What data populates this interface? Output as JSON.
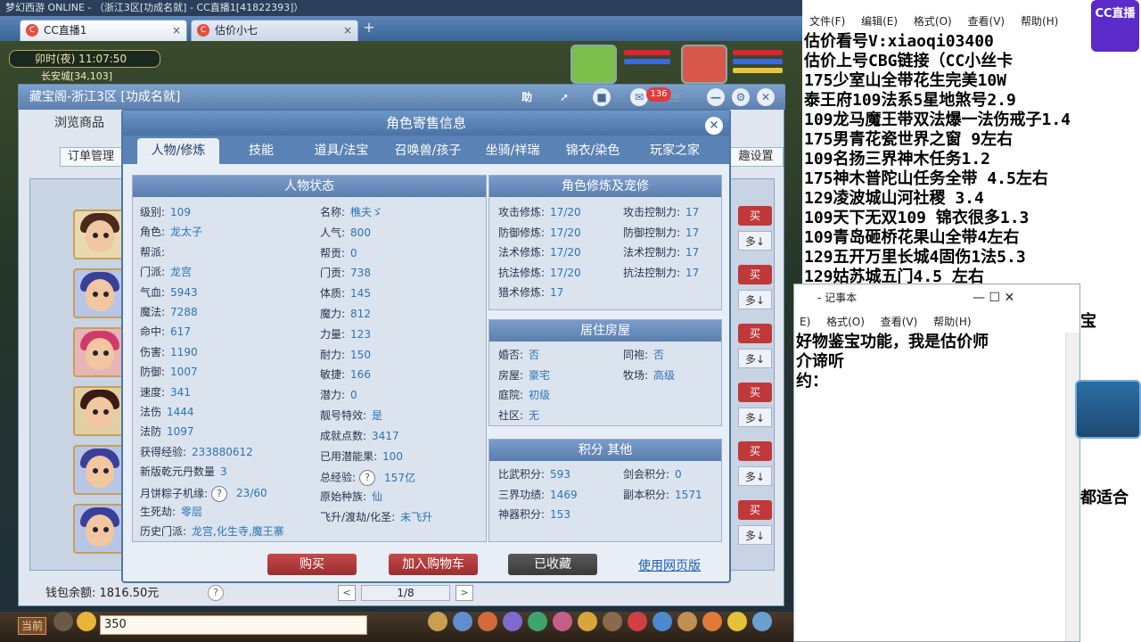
{
  "browser": {
    "title": "梦幻西游 ONLINE - （浙江3区[功成名就] - CC直播1[41822393]）",
    "tabs": [
      {
        "label": "CC直播1",
        "close": "×"
      },
      {
        "label": "估价小七",
        "close": "×"
      }
    ],
    "new_tab": "+"
  },
  "game_hud": {
    "time": "卯时(夜) 11:07:50",
    "location": "长安城[34,103]"
  },
  "shop": {
    "title": "藏宝阁-浙江3区 [功成名就]",
    "help": "助",
    "cart_count": "136",
    "browse_tab": "浏览商品",
    "order_btn": "订单管理",
    "settings_btn": "趣设置",
    "buy_stub": "买",
    "arrow_stub": "多↓",
    "wallet_label": "钱包余额: 1816.50元",
    "wallet_help": "?",
    "pager_prev": "<",
    "pager_text": "1/8",
    "pager_next": ">"
  },
  "modal": {
    "title": "角色寄售信息",
    "close": "×",
    "tabs": [
      "人物/修炼",
      "技能",
      "道具/法宝",
      "召唤兽/孩子",
      "坐骑/祥瑞",
      "锦衣/染色",
      "玩家之家"
    ],
    "status_title": "人物状态",
    "status_left": [
      {
        "k": "级别:",
        "v": "109"
      },
      {
        "k": "角色:",
        "v": "龙太子"
      },
      {
        "k": "帮派:",
        "v": ""
      },
      {
        "k": "门派:",
        "v": "龙宫"
      },
      {
        "k": "气血:",
        "v": "5943"
      },
      {
        "k": "魔法:",
        "v": "7288"
      },
      {
        "k": "命中:",
        "v": "617"
      },
      {
        "k": "伤害:",
        "v": "1190"
      },
      {
        "k": "防御:",
        "v": "1007"
      },
      {
        "k": "速度:",
        "v": "341"
      },
      {
        "k": "法伤",
        "v": "1444"
      },
      {
        "k": "法防",
        "v": "1097"
      },
      {
        "k": "获得经验:",
        "v": "233880612"
      },
      {
        "k": "新版乾元丹数量",
        "v": "3"
      },
      {
        "k": "月饼粽子机缘:",
        "v": "23/60"
      },
      {
        "k": "生死劫:",
        "v": "零层"
      },
      {
        "k": "历史门派:",
        "v": "龙宫,化生寺,魔王寨"
      }
    ],
    "status_right": [
      {
        "k": "名称:",
        "v": "樵夫ゞ"
      },
      {
        "k": "人气:",
        "v": "800"
      },
      {
        "k": "帮贡:",
        "v": "0"
      },
      {
        "k": "门贡:",
        "v": "738"
      },
      {
        "k": "体质:",
        "v": "145"
      },
      {
        "k": "魔力:",
        "v": "812"
      },
      {
        "k": "力量:",
        "v": "123"
      },
      {
        "k": "耐力:",
        "v": "150"
      },
      {
        "k": "敏捷:",
        "v": "166"
      },
      {
        "k": "潜力:",
        "v": "0"
      },
      {
        "k": "靓号特效:",
        "v": "是"
      },
      {
        "k": "成就点数:",
        "v": "3417"
      },
      {
        "k": "已用潜能果:",
        "v": "100"
      },
      {
        "k": "总经验:",
        "v": "157亿"
      },
      {
        "k": "原始种族:",
        "v": "仙"
      },
      {
        "k": "飞升/渡劫/化圣:",
        "v": "未飞升"
      }
    ],
    "cultivation_title": "角色修炼及宠修",
    "cultivation_left": [
      {
        "k": "攻击修炼:",
        "v": "17/20"
      },
      {
        "k": "防御修炼:",
        "v": "17/20"
      },
      {
        "k": "法术修炼:",
        "v": "17/20"
      },
      {
        "k": "抗法修炼:",
        "v": "17/20"
      },
      {
        "k": "猎术修炼:",
        "v": "17"
      }
    ],
    "cultivation_right": [
      {
        "k": "攻击控制力:",
        "v": "17"
      },
      {
        "k": "防御控制力:",
        "v": "17"
      },
      {
        "k": "法术控制力:",
        "v": "17"
      },
      {
        "k": "抗法控制力:",
        "v": "17"
      }
    ],
    "housing_title": "居住房屋",
    "housing_left": [
      {
        "k": "婚否:",
        "v": "否"
      },
      {
        "k": "房屋:",
        "v": "豪宅"
      },
      {
        "k": "庭院:",
        "v": "初级"
      },
      {
        "k": "社区:",
        "v": "无"
      }
    ],
    "housing_right": [
      {
        "k": "同袍:",
        "v": "否"
      },
      {
        "k": "牧场:",
        "v": "高级"
      }
    ],
    "points_title": "积分 其他",
    "points_left": [
      {
        "k": "比武积分:",
        "v": "593"
      },
      {
        "k": "三界功绩:",
        "v": "1469"
      },
      {
        "k": "神器积分:",
        "v": "153"
      }
    ],
    "points_right": [
      {
        "k": "剑会积分:",
        "v": "0"
      },
      {
        "k": "副本积分:",
        "v": "1571"
      }
    ],
    "buttons": {
      "buy": "购买",
      "add_cart": "加入购物车",
      "saved": "已收藏",
      "web": "使用网页版"
    },
    "qmark": "?"
  },
  "bottombar": {
    "chat_tab": "当前",
    "chat_input": "350"
  },
  "notepad_main": {
    "logo": "CC直播",
    "menu": [
      "文件(F)",
      "编辑(E)",
      "格式(O)",
      "查看(V)",
      "帮助(H)"
    ],
    "lines": [
      "估价看号V:xiaoqi03400",
      "估价上号CBG链接（CC小丝卡",
      "175少室山全带花生完美10W",
      "泰王府109法系5星地煞号2.9",
      "109龙马魔王带双法爆一法伤戒子1.4",
      "175男青花瓷世界之窗  9左右",
      "109名扬三界神木任务1.2",
      "175神木普陀山任务全带 4.5左右",
      "129凌波城山河社稷  3.4",
      "109天下无双109  锦衣很多1.3",
      "109青岛砸桥花果山全带4左右",
      "129五开万里长城4固伤1法5.3",
      "129姑苏城五门4.5 左右"
    ]
  },
  "notepad_small": {
    "title": "- 记事本",
    "ctrls": "—    ☐    ✕",
    "menu": [
      "E)",
      "格式(O)",
      "查看(V)",
      "帮助(H)"
    ],
    "lines": [
      "好物鉴宝功能，我是估价师",
      "介谛听",
      "约："
    ],
    "frag_right_1": "宝",
    "frag_right_2": "都适合"
  }
}
